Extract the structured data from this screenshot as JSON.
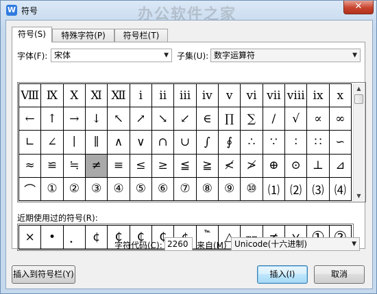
{
  "window": {
    "title": "符号",
    "watermark": "办公软件之家",
    "app_icon_letter": "W",
    "close_glyph": "✕"
  },
  "tabs": [
    {
      "label": "符号(S)",
      "active": true
    },
    {
      "label": "特殊字符(P)",
      "active": false
    },
    {
      "label": "符号栏(T)",
      "active": false
    }
  ],
  "font": {
    "label": "字体(F):",
    "value": "宋体"
  },
  "subset": {
    "label": "子集(U):",
    "value": "数字运算符"
  },
  "symbol_grid": [
    [
      "Ⅷ",
      "Ⅸ",
      "Ⅹ",
      "Ⅺ",
      "Ⅻ",
      "ⅰ",
      "ⅱ",
      "ⅲ",
      "ⅳ",
      "ⅴ",
      "ⅵ",
      "ⅶ",
      "ⅷ",
      "ⅸ",
      "ⅹ"
    ],
    [
      "←",
      "↑",
      "→",
      "↓",
      "↖",
      "↗",
      "↘",
      "↙",
      "∈",
      "∏",
      "∑",
      "∕",
      "√",
      "∝",
      "∞"
    ],
    [
      "∟",
      "∠",
      "∣",
      "∥",
      "∧",
      "∨",
      "∩",
      "∪",
      "∫",
      "∮",
      "∴",
      "∵",
      "∶",
      "∷",
      "∽"
    ],
    [
      "≈",
      "≌",
      "≒",
      "≠",
      "≡",
      "≤",
      "≥",
      "≦",
      "≧",
      "≮",
      "≯",
      "⊕",
      "⊙",
      "⊥",
      "⊿"
    ],
    [
      "⌒",
      "①",
      "②",
      "③",
      "④",
      "⑤",
      "⑥",
      "⑦",
      "⑧",
      "⑨",
      "⑩",
      "⑴",
      "⑵",
      "⑶",
      "⑷"
    ]
  ],
  "selected_symbol": "≠",
  "recent": {
    "label": "近期使用过的符号(R):",
    "symbols": [
      "×",
      "•",
      "．",
      "¢",
      "₵",
      "₵",
      "₵",
      "¢",
      "℡",
      "△",
      "㎜",
      "≠",
      "￥",
      "①",
      "②"
    ]
  },
  "char_code": {
    "label": "字符代码(C):",
    "value": "2260"
  },
  "from": {
    "label": "来自(M)",
    "value": "Unicode(十六进制)"
  },
  "buttons": {
    "insert_to_bar": "插入到符号栏(Y)",
    "insert": "插入(I)",
    "cancel": "取消"
  }
}
